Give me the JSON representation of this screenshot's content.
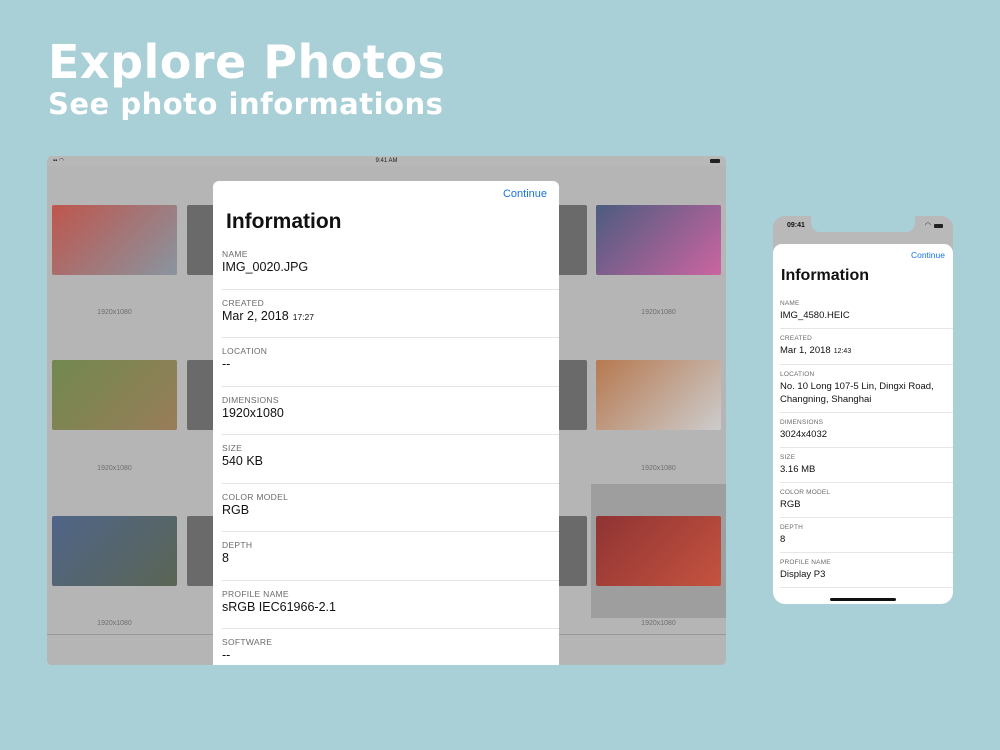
{
  "hero": {
    "title": "Explore Photos",
    "subtitle": "See photo informations"
  },
  "ipad": {
    "status_time": "9:41 AM",
    "thumbs": [
      {
        "label": "1920x1080",
        "colors": [
          "#c2362a",
          "#7a8a99"
        ]
      },
      {
        "label": "1920x1080",
        "colors": [
          "#2a3e6e",
          "#d34a9a"
        ]
      },
      {
        "label": "1920x1080",
        "colors": [
          "#5a7a2e",
          "#8f6a3a"
        ]
      },
      {
        "label": "1920x1080",
        "colors": [
          "#b7652e",
          "#d4d4d4"
        ]
      },
      {
        "label": "1920x1080",
        "colors": [
          "#2e4a7a",
          "#3c4a34"
        ]
      },
      {
        "label": "1920x1080",
        "colors": [
          "#8a1010",
          "#d23a20"
        ]
      }
    ],
    "sheet": {
      "continue": "Continue",
      "title": "Information",
      "rows": [
        {
          "key": "NAME",
          "value": "IMG_0020.JPG",
          "time": ""
        },
        {
          "key": "CREATED",
          "value": "Mar 2, 2018",
          "time": "17:27"
        },
        {
          "key": "LOCATION",
          "value": "--",
          "time": ""
        },
        {
          "key": "DIMENSIONS",
          "value": "1920x1080",
          "time": ""
        },
        {
          "key": "SIZE",
          "value": "540 KB",
          "time": ""
        },
        {
          "key": "COLOR MODEL",
          "value": "RGB",
          "time": ""
        },
        {
          "key": "DEPTH",
          "value": "8",
          "time": ""
        },
        {
          "key": "PROFILE NAME",
          "value": "sRGB IEC61966-2.1",
          "time": ""
        },
        {
          "key": "SOFTWARE",
          "value": "--",
          "time": ""
        }
      ]
    }
  },
  "iphone": {
    "status_time": "09:41",
    "sheet": {
      "continue": "Continue",
      "title": "Information",
      "rows": [
        {
          "key": "NAME",
          "value": "IMG_4580.HEIC",
          "time": ""
        },
        {
          "key": "CREATED",
          "value": "Mar 1, 2018",
          "time": "12:43"
        },
        {
          "key": "LOCATION",
          "value": "No. 10 Long 107-5 Lin, Dingxi Road, Changning, Shanghai",
          "time": ""
        },
        {
          "key": "DIMENSIONS",
          "value": "3024x4032",
          "time": ""
        },
        {
          "key": "SIZE",
          "value": "3.16 MB",
          "time": ""
        },
        {
          "key": "COLOR MODEL",
          "value": "RGB",
          "time": ""
        },
        {
          "key": "DEPTH",
          "value": "8",
          "time": ""
        },
        {
          "key": "PROFILE NAME",
          "value": "Display P3",
          "time": ""
        }
      ]
    }
  },
  "colors": {
    "background": "#a9cfd7",
    "accent": "#1a73e8"
  }
}
